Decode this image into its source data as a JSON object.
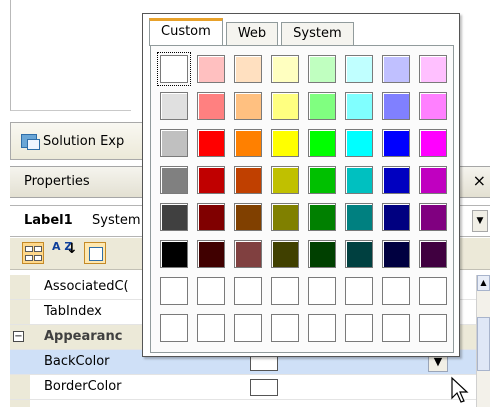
{
  "solution_explorer": {
    "tab_label": "Solution Exp"
  },
  "properties": {
    "header_title": "Properties",
    "close_glyph": "×",
    "object_name": "Label1",
    "object_type": "System",
    "dropdown_glyph": "▼",
    "toolbar": {
      "az_label": "A Z"
    },
    "rows": [
      {
        "name": "AssociatedC(",
        "kind": "property"
      },
      {
        "name": "TabIndex",
        "kind": "property"
      },
      {
        "name": "Appearanc",
        "kind": "category",
        "expander": "−"
      },
      {
        "name": "BackColor",
        "kind": "property",
        "selected": true,
        "value_color": "#ffffff"
      },
      {
        "name": "BorderColor",
        "kind": "property",
        "value_color": "#ffffff"
      }
    ]
  },
  "color_picker": {
    "tabs": [
      {
        "label": "Custom",
        "active": true
      },
      {
        "label": "Web",
        "active": false
      },
      {
        "label": "System",
        "active": false
      }
    ],
    "palette": [
      [
        "#ffffff",
        "#ffc0c0",
        "#ffe0c0",
        "#ffffc0",
        "#c0ffc0",
        "#c0ffff",
        "#c0c0ff",
        "#ffc0ff"
      ],
      [
        "#e0e0e0",
        "#ff8080",
        "#ffc080",
        "#ffff80",
        "#80ff80",
        "#80ffff",
        "#8080ff",
        "#ff80ff"
      ],
      [
        "#c0c0c0",
        "#ff0000",
        "#ff8000",
        "#ffff00",
        "#00ff00",
        "#00ffff",
        "#0000ff",
        "#ff00ff"
      ],
      [
        "#808080",
        "#c00000",
        "#c04000",
        "#c0c000",
        "#00c000",
        "#00c0c0",
        "#0000c0",
        "#c000c0"
      ],
      [
        "#404040",
        "#800000",
        "#804000",
        "#808000",
        "#008000",
        "#008080",
        "#000080",
        "#800080"
      ],
      [
        "#000000",
        "#400000",
        "#804040",
        "#404000",
        "#004000",
        "#004040",
        "#000040",
        "#400040"
      ],
      [
        "#ffffff",
        "#ffffff",
        "#ffffff",
        "#ffffff",
        "#ffffff",
        "#ffffff",
        "#ffffff",
        "#ffffff"
      ],
      [
        "#ffffff",
        "#ffffff",
        "#ffffff",
        "#ffffff",
        "#ffffff",
        "#ffffff",
        "#ffffff",
        "#ffffff"
      ]
    ],
    "selected_swatch": [
      0,
      0
    ]
  }
}
